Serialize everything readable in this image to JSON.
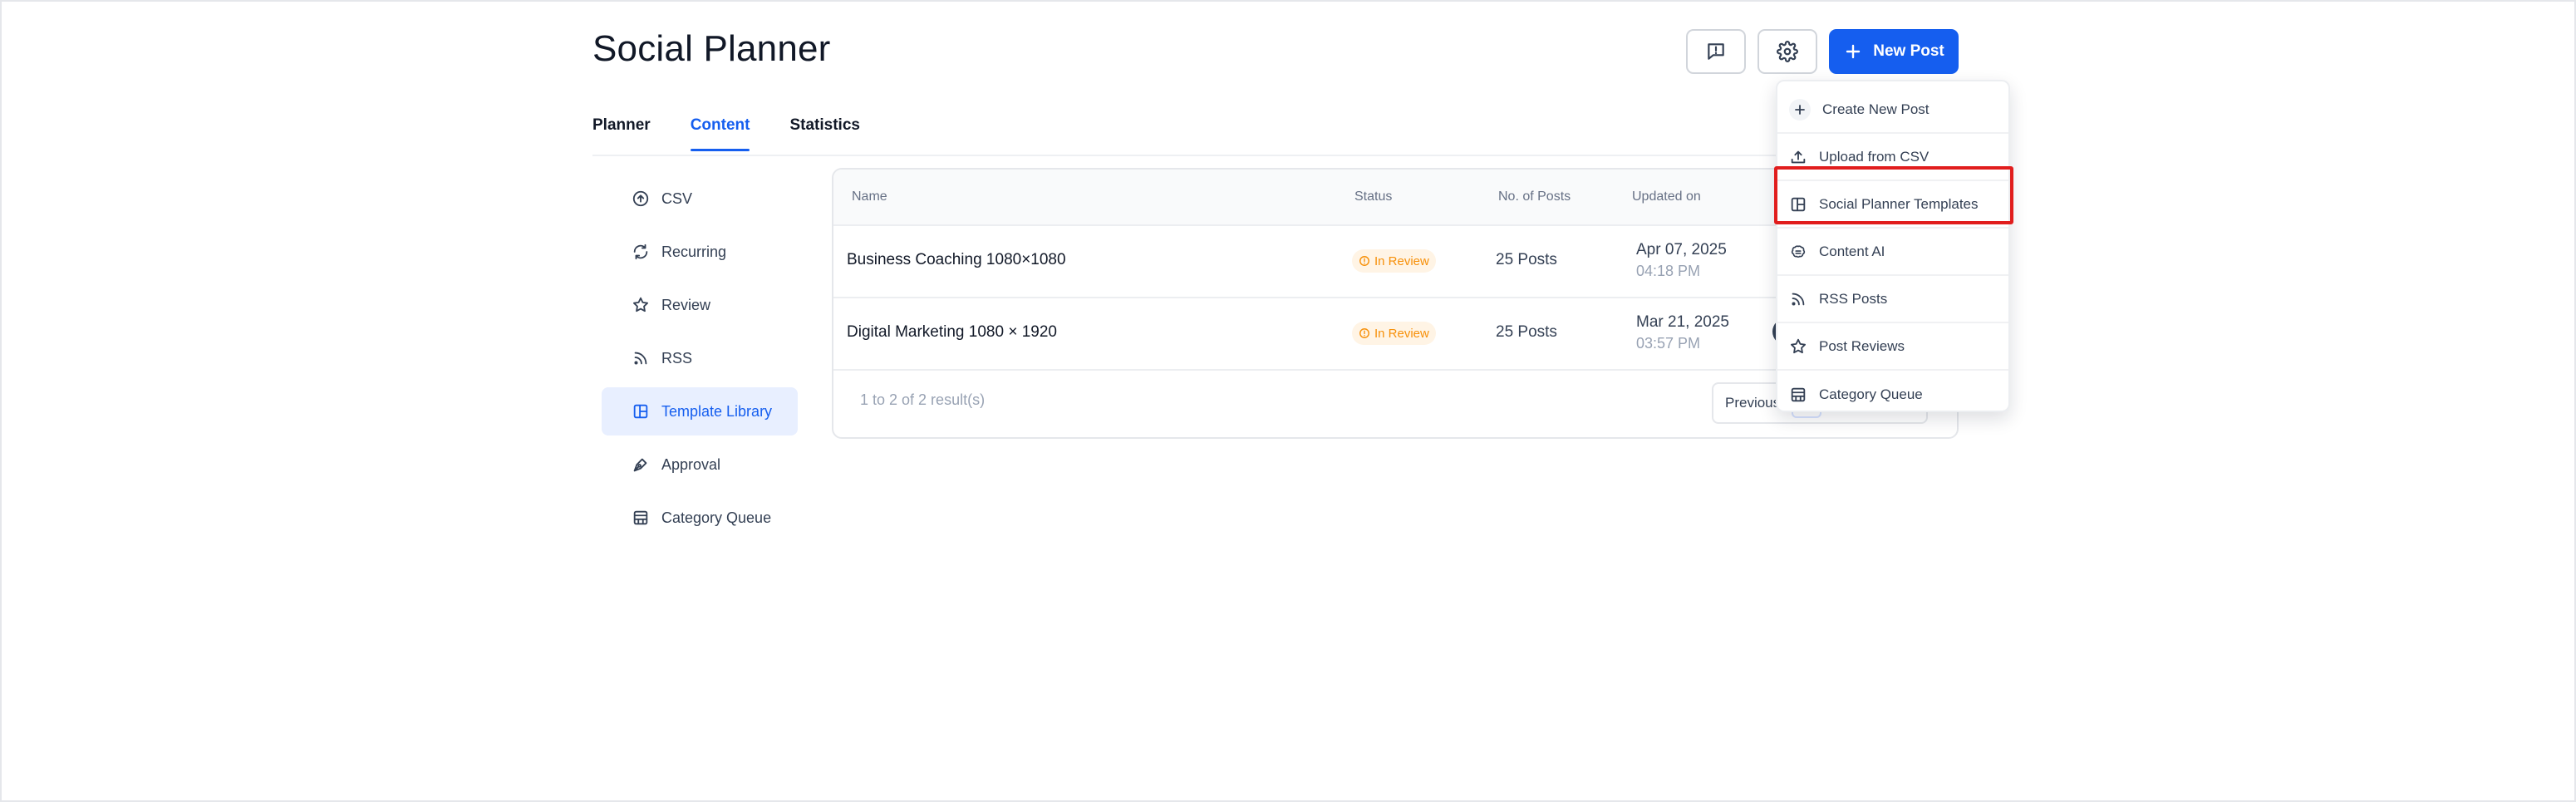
{
  "header": {
    "title": "Social Planner",
    "new_post_label": "New Post"
  },
  "tabs": [
    {
      "label": "Planner"
    },
    {
      "label": "Content"
    },
    {
      "label": "Statistics"
    }
  ],
  "sidebar": {
    "items": [
      {
        "label": "CSV",
        "icon": "upload-circle-icon"
      },
      {
        "label": "Recurring",
        "icon": "refresh-icon"
      },
      {
        "label": "Review",
        "icon": "star-icon"
      },
      {
        "label": "RSS",
        "icon": "rss-icon"
      },
      {
        "label": "Template Library",
        "icon": "template-icon"
      },
      {
        "label": "Approval",
        "icon": "pen-tool-icon"
      },
      {
        "label": "Category Queue",
        "icon": "calendar-grid-icon"
      }
    ]
  },
  "table": {
    "columns": [
      "Name",
      "Status",
      "No. of Posts",
      "Updated on"
    ],
    "rows": [
      {
        "name": "Business Coaching 1080×1080",
        "status": "In Review",
        "posts": "25 Posts",
        "date": "Apr 07, 2025",
        "time": "04:18 PM"
      },
      {
        "name": "Digital Marketing 1080 × 1920",
        "status": "In Review",
        "posts": "25 Posts",
        "date": "Mar 21, 2025",
        "time": "03:57 PM"
      }
    ],
    "results_text": "1 to 2 of 2 result(s)",
    "previous_label": "Previous"
  },
  "dropdown": {
    "items": [
      {
        "label": "Create New Post",
        "icon": "plus-icon"
      },
      {
        "label": "Upload from CSV",
        "icon": "upload-icon"
      },
      {
        "label": "Social Planner Templates",
        "icon": "template-icon"
      },
      {
        "label": "Content AI",
        "icon": "ai-brain-icon"
      },
      {
        "label": "RSS Posts",
        "icon": "rss-icon"
      },
      {
        "label": "Post Reviews",
        "icon": "star-icon"
      },
      {
        "label": "Category Queue",
        "icon": "calendar-grid-icon"
      }
    ]
  },
  "colors": {
    "primary": "#155eef",
    "badge_text": "#f79009",
    "badge_bg": "#fff4e5",
    "highlight": "#e11d1d"
  }
}
